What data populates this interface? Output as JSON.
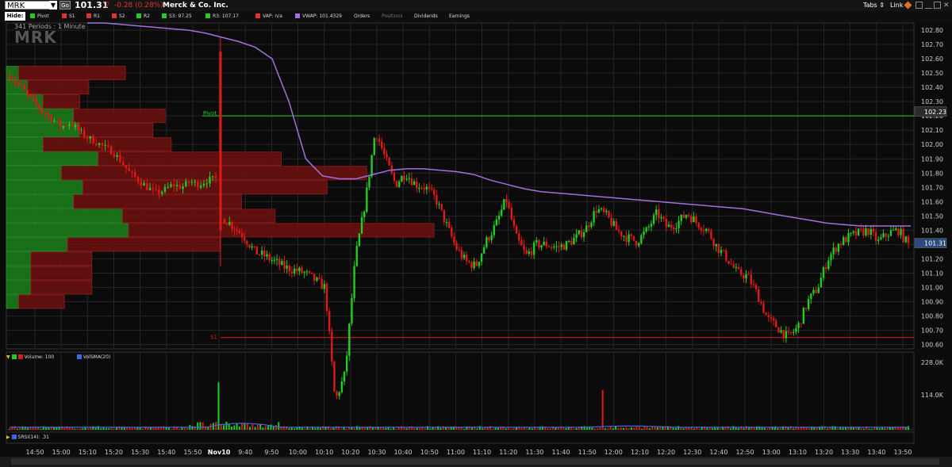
{
  "header": {
    "symbol": "MRK",
    "go_label": "Go",
    "last_price": "101.31",
    "change": "-0.28 (0.28%)",
    "company": "Merck & Co. Inc.",
    "tabs_label": "Tabs",
    "link_label": "Link",
    "down_color": "#e03030"
  },
  "legend": {
    "hide_label": "Hide:",
    "items": [
      {
        "label": "Pivot",
        "color": "#22cc22"
      },
      {
        "label": "S1",
        "color": "#e03030"
      },
      {
        "label": "R1",
        "color": "#e03030"
      },
      {
        "label": "S2",
        "color": "#e03030"
      },
      {
        "label": "R2",
        "color": "#22cc22"
      },
      {
        "label": "S3: 97.25",
        "color": "#22cc22"
      },
      {
        "label": "R3: 107.17",
        "color": "#22cc22"
      },
      {
        "label": "VAP: n/a",
        "color": "#e03030"
      },
      {
        "label": "VWAP: 101.4329",
        "color": "#a070e0"
      }
    ],
    "tabs": [
      "Orders",
      "Positions",
      "Dividends",
      "Earnings"
    ]
  },
  "chart_data": [
    {
      "type": "candlestick",
      "period_label": "341  Periods : 1 Minute",
      "watermark": "MRK",
      "y_ticks": [
        "102.80",
        "102.70",
        "102.60",
        "102.50",
        "102.40",
        "102.30",
        "102.20",
        "102.10",
        "102.00",
        "101.90",
        "101.80",
        "101.70",
        "101.60",
        "101.50",
        "101.40",
        "101.30",
        "101.20",
        "101.10",
        "101.00",
        "100.90",
        "100.80",
        "100.70",
        "100.60"
      ],
      "ylim": [
        100.57,
        102.85
      ],
      "x_ticks": [
        "14:50",
        "15:00",
        "15:10",
        "15:20",
        "15:30",
        "15:40",
        "15:50",
        "Nov10",
        "9:40",
        "9:50",
        "10:00",
        "10:10",
        "10:20",
        "10:30",
        "10:40",
        "10:50",
        "11:00",
        "11:10",
        "11:20",
        "11:30",
        "11:40",
        "11:50",
        "12:00",
        "12:10",
        "12:20",
        "12:30",
        "12:40",
        "12:50",
        "13:00",
        "13:10",
        "13:20",
        "13:30",
        "13:40",
        "13:50"
      ],
      "price_path": [
        101.48,
        101.42,
        101.35,
        101.25,
        101.22,
        101.18,
        101.14,
        101.12,
        101.1,
        101.05,
        101.0,
        100.2,
        100.4,
        101.2,
        101.6,
        102.1,
        101.9,
        101.72,
        101.8,
        101.72,
        101.7,
        101.62,
        101.45,
        101.28,
        101.18,
        101.15,
        101.32,
        101.44,
        101.62,
        101.35,
        101.22,
        101.3,
        101.3,
        101.28,
        101.3,
        101.35,
        101.42,
        101.55,
        101.5,
        101.4,
        101.35,
        101.32,
        101.4,
        101.52,
        101.42,
        101.45,
        101.52,
        101.45,
        101.4,
        101.28,
        101.2,
        101.1,
        101.08,
        100.95,
        100.78,
        100.72,
        100.65,
        100.72,
        100.9,
        101.0,
        101.2,
        101.3,
        101.35,
        101.38,
        101.4,
        101.32,
        101.38,
        101.4,
        101.3
      ],
      "pre_path": [
        102.48,
        102.42,
        102.35,
        102.28,
        102.22,
        102.18,
        102.12,
        102.15,
        102.1,
        102.05,
        102.02,
        101.98,
        101.95,
        101.88,
        101.8,
        101.75,
        101.7,
        101.66,
        101.68,
        101.72,
        101.7,
        101.74,
        101.72,
        101.75,
        101.76
      ],
      "vwap": [
        102.85,
        102.85,
        102.84,
        102.83,
        102.82,
        102.81,
        102.8,
        102.78,
        102.75,
        102.72,
        102.68,
        102.6,
        102.3,
        101.9,
        101.78,
        101.76,
        101.76,
        101.79,
        101.82,
        101.83,
        101.83,
        101.82,
        101.81,
        101.79,
        101.75,
        101.72,
        101.69,
        101.67,
        101.66,
        101.65,
        101.64,
        101.63,
        101.62,
        101.61,
        101.6,
        101.59,
        101.58,
        101.57,
        101.56,
        101.55,
        101.53,
        101.51,
        101.49,
        101.47,
        101.45,
        101.44,
        101.43,
        101.43,
        101.43,
        101.43
      ],
      "pivot": {
        "label": "Pivot",
        "value": 102.2
      },
      "s1": {
        "label": "S1",
        "value": 100.65
      },
      "price_tags": [
        {
          "value": 102.23,
          "label": "102.23"
        },
        {
          "value": 101.31,
          "label": "101.31"
        }
      ],
      "volume_at_price": [
        {
          "price": 102.5,
          "up": 0.04,
          "down": 0.35
        },
        {
          "price": 102.4,
          "up": 0.07,
          "down": 0.2
        },
        {
          "price": 102.3,
          "up": 0.12,
          "down": 0.12
        },
        {
          "price": 102.2,
          "up": 0.22,
          "down": 0.3
        },
        {
          "price": 102.1,
          "up": 0.24,
          "down": 0.24
        },
        {
          "price": 102.0,
          "up": 0.12,
          "down": 0.42
        },
        {
          "price": 101.9,
          "up": 0.3,
          "down": 0.6
        },
        {
          "price": 101.8,
          "up": 0.18,
          "down": 1.0
        },
        {
          "price": 101.7,
          "up": 0.25,
          "down": 0.8
        },
        {
          "price": 101.6,
          "up": 0.22,
          "down": 0.55
        },
        {
          "price": 101.5,
          "up": 0.38,
          "down": 0.5
        },
        {
          "price": 101.4,
          "up": 0.4,
          "down": 1.0
        },
        {
          "price": 101.3,
          "up": 0.2,
          "down": 0.5
        },
        {
          "price": 101.2,
          "up": 0.08,
          "down": 0.2
        },
        {
          "price": 101.1,
          "up": 0.08,
          "down": 0.2
        },
        {
          "price": 101.0,
          "up": 0.08,
          "down": 0.2
        },
        {
          "price": 100.9,
          "up": 0.04,
          "down": 0.15
        }
      ]
    },
    {
      "type": "bar",
      "legend": [
        "Volume: 100",
        "VolSMA(20)"
      ],
      "y_ticks": [
        "228.0K",
        "114.0K"
      ],
      "ylim": [
        0,
        228000
      ],
      "spikes": [
        {
          "at": 0.232,
          "value": 155000
        },
        {
          "at": 0.66,
          "value": 130000
        }
      ]
    },
    {
      "type": "line",
      "legend": [
        "SRSI(14): .31"
      ]
    }
  ],
  "colors": {
    "up": "#22cc22",
    "down": "#e01818",
    "vwap": "#a070e0",
    "vsma": "#3a6ae0",
    "grid": "#262626"
  }
}
